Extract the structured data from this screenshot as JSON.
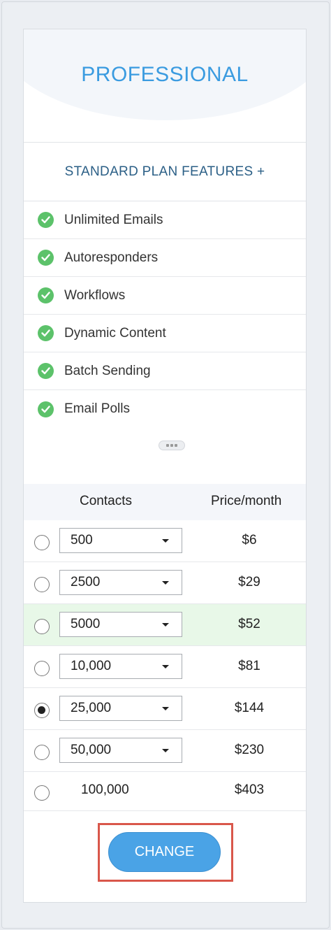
{
  "plan": {
    "title": "PROFESSIONAL",
    "subtitle": "STANDARD PLAN FEATURES +",
    "features": [
      "Unlimited Emails",
      "Autoresponders",
      "Workflows",
      "Dynamic Content",
      "Batch Sending",
      "Email Polls"
    ]
  },
  "pricing": {
    "col_contacts": "Contacts",
    "col_price": "Price/month",
    "rows": [
      {
        "contacts": "500",
        "price": "$6"
      },
      {
        "contacts": "2500",
        "price": "$29"
      },
      {
        "contacts": "5000",
        "price": "$52"
      },
      {
        "contacts": "10,000",
        "price": "$81"
      },
      {
        "contacts": "25,000",
        "price": "$144"
      },
      {
        "contacts": "50,000",
        "price": "$230"
      },
      {
        "contacts": "100,000",
        "price": "$403"
      }
    ],
    "selected_contacts": "25,000",
    "highlighted_contacts": "5000"
  },
  "actions": {
    "change_label": "CHANGE"
  },
  "colors": {
    "accent": "#3a9be0",
    "check": "#5cc26a",
    "highlight_row": "#e8f8e8",
    "button": "#4aa3e6",
    "focus_outline": "#d9574b"
  },
  "icons": {
    "feature": "check-circle-icon",
    "expand": "ellipsis-icon",
    "dropdown": "caret-down-icon"
  }
}
